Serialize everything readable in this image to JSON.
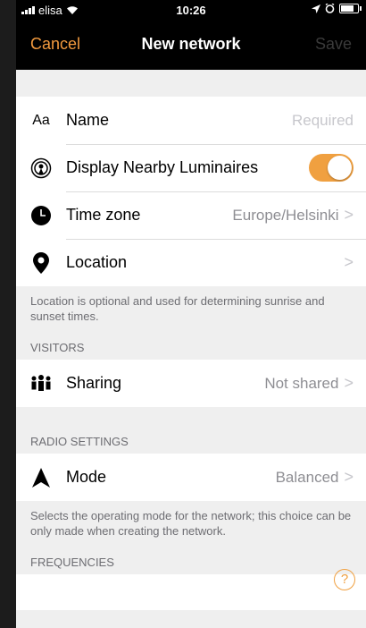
{
  "statusbar": {
    "carrier": "elisa",
    "time": "10:26"
  },
  "nav": {
    "cancel": "Cancel",
    "title": "New network",
    "save": "Save"
  },
  "rows": {
    "name": {
      "label": "Name",
      "placeholder": "Required",
      "icon_text": "Aa"
    },
    "nearby": {
      "label": "Display Nearby Luminaires",
      "toggle_on": true
    },
    "timezone": {
      "label": "Time zone",
      "value": "Europe/Helsinki"
    },
    "location": {
      "label": "Location"
    }
  },
  "location_note": "Location is optional and used for determining sunrise and sunset times.",
  "visitors": {
    "header": "VISITORS",
    "sharing_label": "Sharing",
    "sharing_value": "Not shared"
  },
  "radio": {
    "header": "RADIO SETTINGS",
    "mode_label": "Mode",
    "mode_value": "Balanced",
    "note": "Selects the operating mode for the network; this choice can be only made when creating the network."
  },
  "frequencies": {
    "header": "FREQUENCIES"
  },
  "colors": {
    "accent": "#f0a040",
    "navbar": "#000000",
    "cancel": "#f29a3e"
  },
  "icons": [
    "wifi-icon",
    "location-arrow-icon",
    "alarm-icon",
    "battery-icon",
    "broadcast-icon",
    "clock-icon",
    "pin-icon",
    "people-icon",
    "mode-icon",
    "chevron-right-icon",
    "help-icon"
  ]
}
